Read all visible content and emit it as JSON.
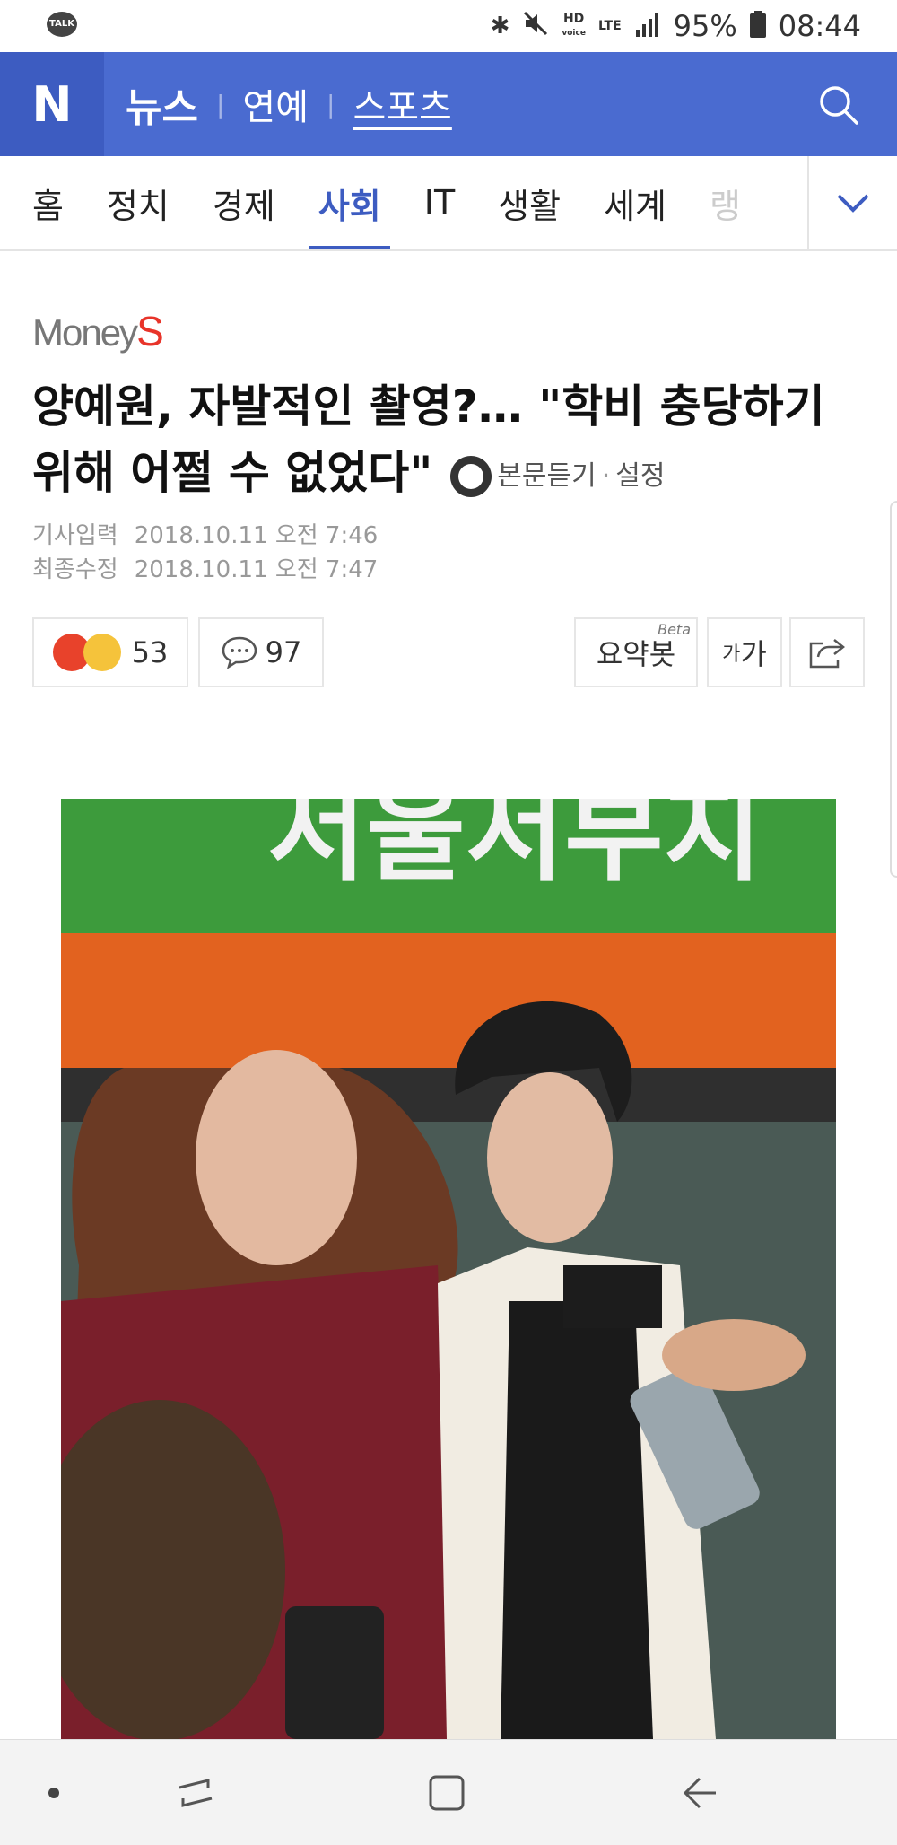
{
  "status_bar": {
    "talk_label": "TALK",
    "hd_label": "HD",
    "voice_label": "voice",
    "lte_label": "LTE",
    "battery": "95%",
    "time": "08:44"
  },
  "navbar": {
    "logo": "N",
    "primary": "뉴스",
    "links": [
      "연예",
      "스포츠"
    ],
    "color": "#4a6bd0"
  },
  "tabs": [
    "홈",
    "정치",
    "경제",
    "사회",
    "IT",
    "생활",
    "세계",
    "랭"
  ],
  "active_tab": "사회",
  "article": {
    "publisher_prefix": "Money",
    "publisher_suffix": "S",
    "headline": "양예원, 자발적인 촬영?… \"학비 충당하기 위해 어쩔 수 없었다\"",
    "listen_label": "본문듣기",
    "settings_label": "설정",
    "input_label": "기사입력",
    "input_date": "2018.10.11 오전 7:46",
    "modified_label": "최종수정",
    "modified_date": "2018.10.11 오전 7:47"
  },
  "actions": {
    "reaction_count": "53",
    "comment_count": "97",
    "summary_label": "요약봇",
    "summary_badge": "Beta",
    "font_small": "가",
    "font_large": "가"
  },
  "photo": {
    "sign_text": "서울서부지"
  }
}
